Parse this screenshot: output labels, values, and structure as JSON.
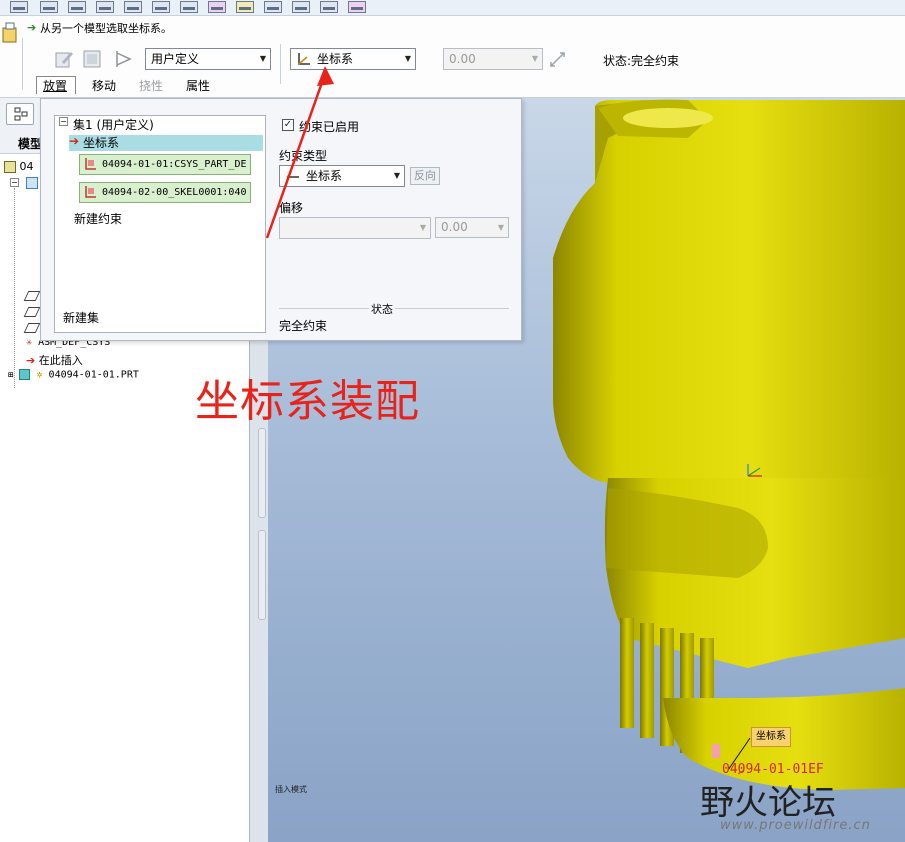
{
  "message": "从另一个模型选取坐标系。",
  "dashboard": {
    "set_type": "用户定义",
    "constraint_type": "坐标系",
    "offset_value": "0.00",
    "status": "状态:完全约束",
    "tabs": [
      "放置",
      "移动",
      "挠性",
      "属性"
    ]
  },
  "tree": {
    "tab_label": "模型",
    "rows": [
      "04",
      "ASM_DEF_CSYS",
      "在此插入",
      "04094-01-01.PRT"
    ]
  },
  "placement": {
    "set_label": "集1 (用户定义)",
    "selected_constraint": "坐标系",
    "refs": [
      "04094-01-01:CSYS_PART_DE",
      "04094-02-00_SKEL0001:040"
    ],
    "new_constraint": "新建约束",
    "new_set": "新建集",
    "enabled_label": "约束已启用",
    "constraint_type_label": "约束类型",
    "constraint_type_value": "坐标系",
    "flip_label": "反向",
    "offset_label": "偏移",
    "offset_value": "0.00",
    "status_label": "状态",
    "status_value": "完全约束"
  },
  "annotation": "坐标系装配",
  "viewport": {
    "callout_label": "坐标系",
    "ref_label": "04094-01-01EF",
    "insert_mode": "插入模式"
  },
  "watermark": {
    "logo": "野火论坛",
    "url": "www.proewildfire.cn"
  },
  "colors": {
    "part_yellow": "#d8d100",
    "annotation_red": "#e8231a",
    "chip_green": "#d9f0cf"
  }
}
